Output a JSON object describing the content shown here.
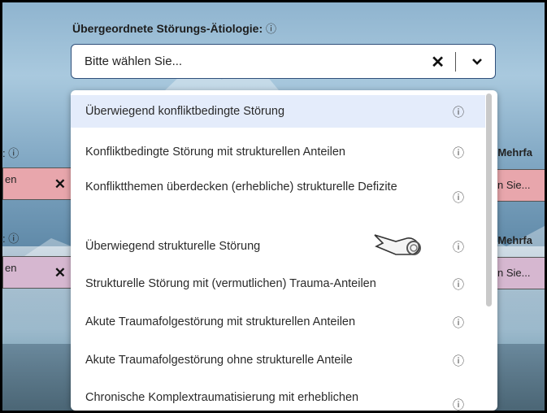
{
  "form": {
    "field_label": "Übergeordnete Störungs-Ätiologie:",
    "info_glyph": "ⓘ",
    "select": {
      "placeholder": "Bitte wählen Sie...",
      "clear_glyph": "✕",
      "chevron_glyph": "⌄"
    }
  },
  "left_panel": {
    "labels": [
      ": ⓘ",
      ": ⓘ"
    ],
    "chips": [
      {
        "text": "en",
        "clear": "✕",
        "color": "#e8a6ac"
      },
      {
        "text": "en",
        "clear": "✕",
        "color": "#d6b7d0"
      }
    ]
  },
  "right_panel": {
    "labels": [
      "(Mehrfa",
      "(Mehrfa"
    ],
    "chips": [
      {
        "text": "n Sie...",
        "color": "#e8a6ac"
      },
      {
        "text": "n Sie...",
        "color": "#d6b7d0"
      }
    ]
  },
  "dropdown": {
    "options": [
      {
        "label": "Überwiegend konfliktbedingte Störung",
        "info": "ⓘ",
        "highlighted": true
      },
      {
        "label": "Konfliktbedingte Störung mit strukturellen Anteilen",
        "info": "ⓘ"
      },
      {
        "label": "Konfliktthemen überdecken (erhebliche) strukturelle Defizite",
        "info": "ⓘ"
      },
      {
        "label": "Überwiegend strukturelle Störung",
        "info": "ⓘ"
      },
      {
        "label": "Strukturelle Störung mit (vermutlichen) Trauma-Anteilen",
        "info": "ⓘ"
      },
      {
        "label": "Akute Traumafolgestörung mit strukturellen Anteilen",
        "info": "ⓘ"
      },
      {
        "label": "Akute Traumafolgestörung ohne strukturelle Anteile",
        "info": "ⓘ"
      },
      {
        "label": "Chronische Komplextraumatisierung mit erheblichen",
        "info": "ⓘ"
      }
    ]
  },
  "colors": {
    "accent_border": "#2f4f7a",
    "highlight": "#e4ecfb"
  }
}
